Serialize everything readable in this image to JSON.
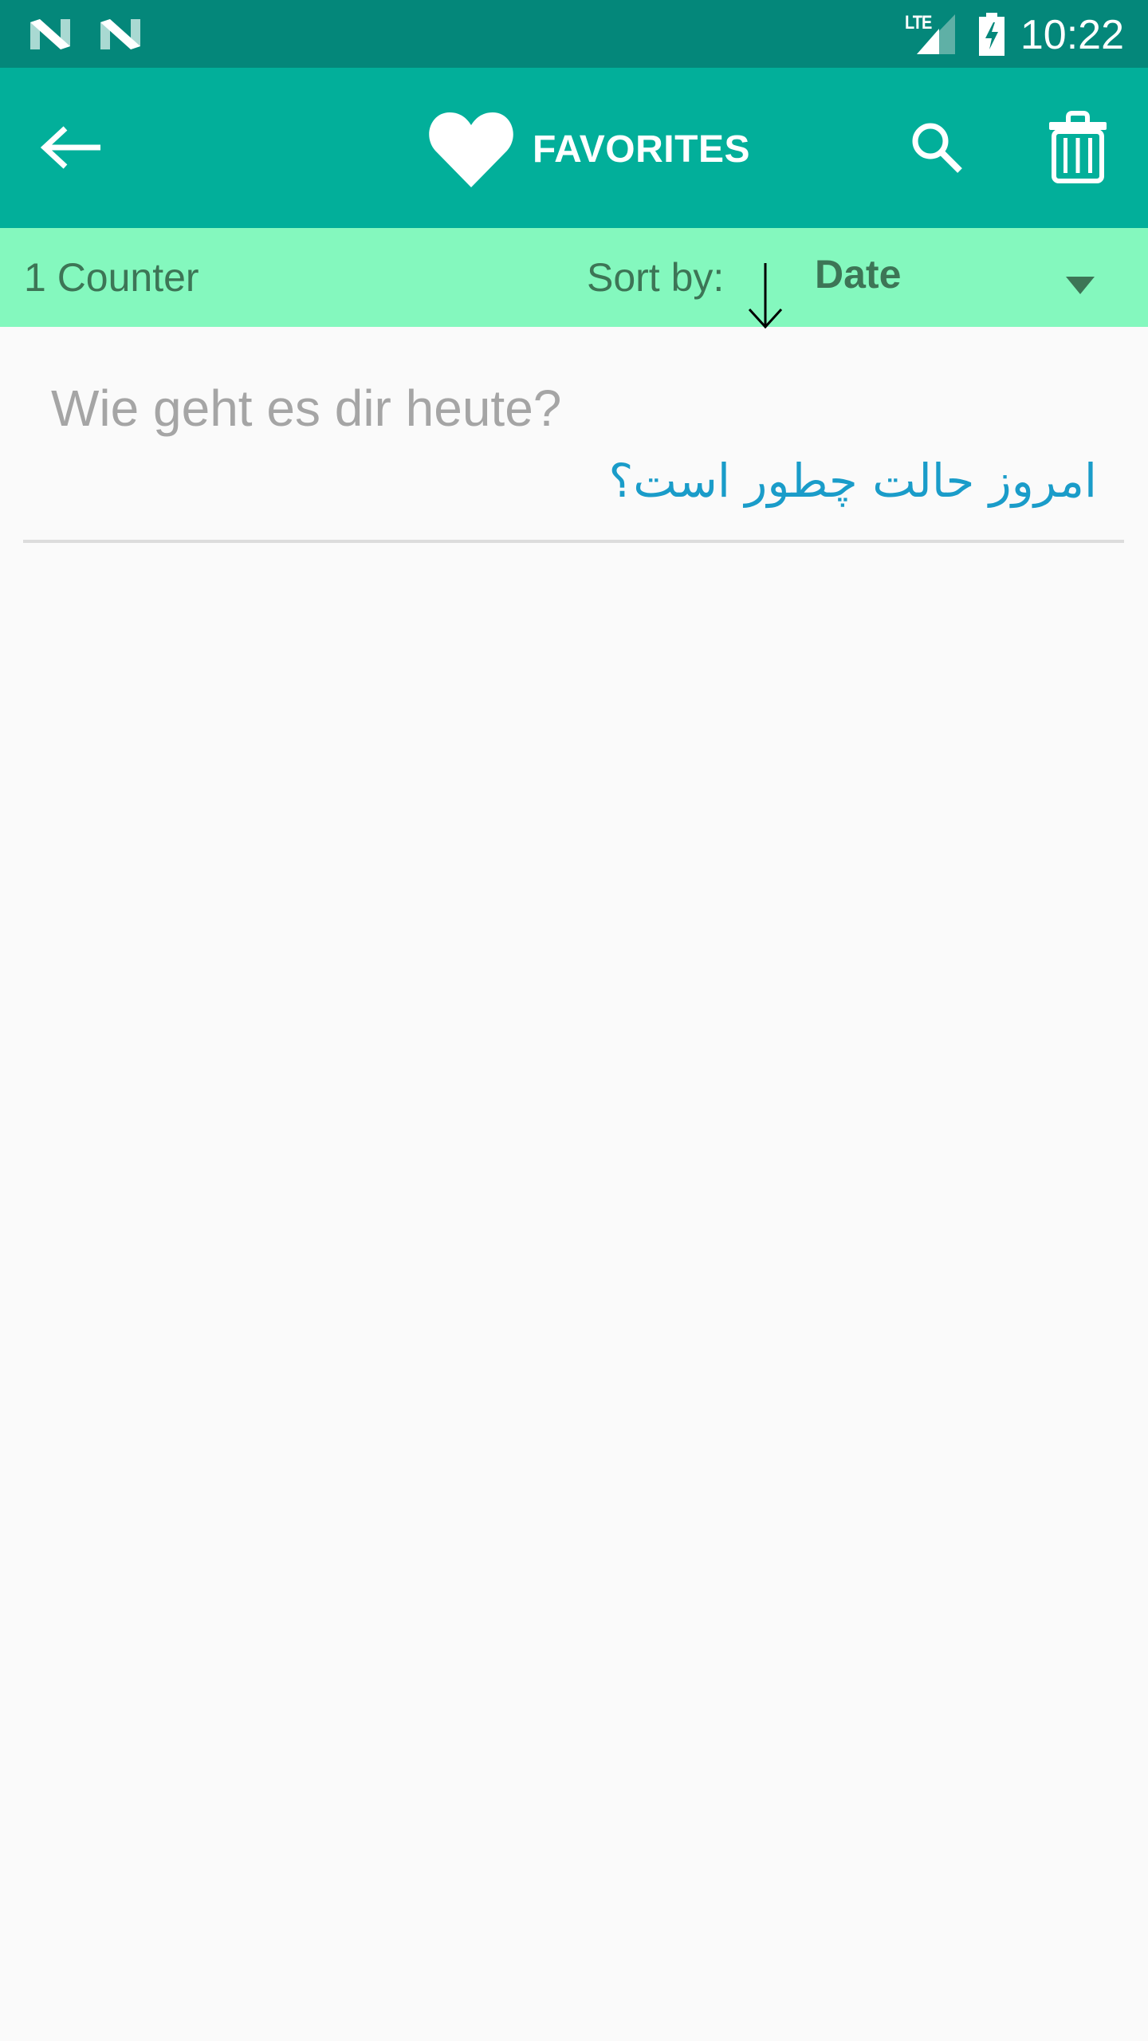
{
  "status_bar": {
    "notification_icons": [
      "android-n-icon",
      "android-n-icon"
    ],
    "network_label": "LTE",
    "signal_icon": "signal-icon",
    "battery_icon": "battery-charging-icon",
    "time": "10:22"
  },
  "toolbar": {
    "back_icon": "arrow-back-icon",
    "title_icon": "heart-icon",
    "title": "FAVORITES",
    "search_icon": "search-icon",
    "delete_icon": "trash-icon"
  },
  "sort_bar": {
    "counter_label": "1 Counter",
    "sort_label": "Sort by:",
    "sort_direction_icon": "arrow-down-icon",
    "sort_selected": "Date"
  },
  "favorites": [
    {
      "source": "Wie geht es dir heute?",
      "translation": "امروز حالت چطور است؟"
    }
  ],
  "colors": {
    "status_bar": "#04877a",
    "toolbar": "#02af9a",
    "sort_bar": "#84f8be",
    "sort_text": "#3d7556",
    "source_text": "#a5a5a5",
    "translation_text": "#1a9cc9",
    "background": "#fafafa",
    "divider": "#dcdcdc"
  }
}
